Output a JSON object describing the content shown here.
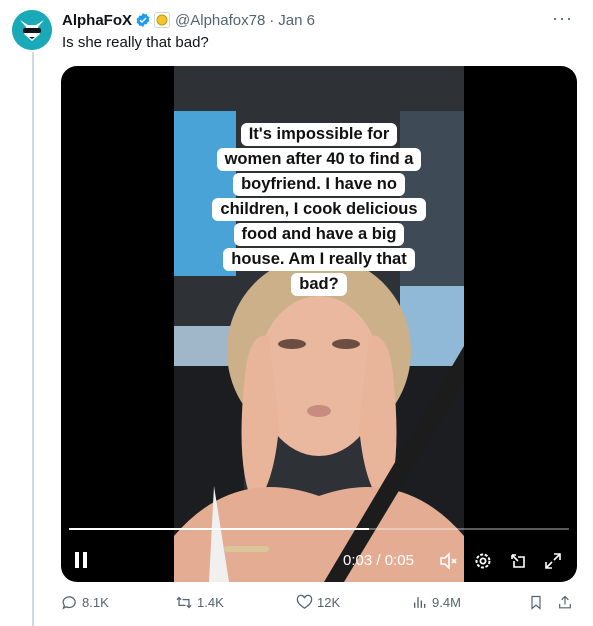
{
  "author": {
    "name": "AlphaFoX",
    "handle": "@Alphafox78",
    "separator": "·",
    "date": "Jan 6",
    "avatar_icon": "fox-mask-icon",
    "verified_icon": "verified-badge-icon",
    "affiliate_icon": "gold-coin-icon"
  },
  "tweet": {
    "text": "Is she really that bad?",
    "more_icon": "more-icon",
    "more_label": "···"
  },
  "video": {
    "caption_lines": [
      "It's impossible for",
      "women after 40 to find a",
      "boyfriend. I have no",
      "children, I cook delicious",
      "food and have a big",
      "house. Am I really that",
      "bad?"
    ],
    "time_current": "0:03",
    "time_sep": " / ",
    "time_total": "0:05",
    "progress": 0.6,
    "icons": [
      "pause-icon",
      "mute-icon",
      "settings-icon",
      "pip-icon",
      "fullscreen-icon"
    ]
  },
  "actions": {
    "replies": "8.1K",
    "reposts": "1.4K",
    "likes": "12K",
    "views": "9.4M"
  },
  "colors": {
    "accent": "#1d9bf0",
    "muted": "#536471",
    "avatar_bg": "#1aa9b8"
  }
}
